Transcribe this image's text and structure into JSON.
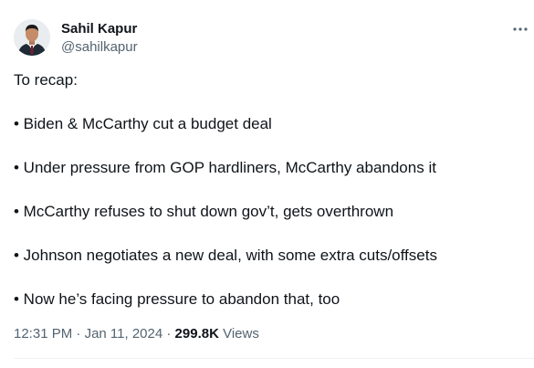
{
  "author": {
    "name": "Sahil Kapur",
    "handle": "@sahilkapur"
  },
  "tweet": {
    "lines": [
      "To recap:",
      "• Biden & McCarthy cut a budget deal",
      "• Under pressure from GOP hardliners, McCarthy abandons it",
      "• McCarthy refuses to shut down gov’t, gets overthrown",
      "• Johnson negotiates a new deal, with some extra cuts/offsets",
      "• Now he’s facing pressure to abandon that, too"
    ]
  },
  "meta": {
    "time": "12:31 PM",
    "separator": "·",
    "date": "Jan 11, 2024",
    "views_count": "299.8K",
    "views_label": "Views"
  },
  "icons": {
    "more": "more-horizontal-icon"
  },
  "colors": {
    "text_primary": "#0f1419",
    "text_secondary": "#536471",
    "divider": "#eff3f4"
  }
}
